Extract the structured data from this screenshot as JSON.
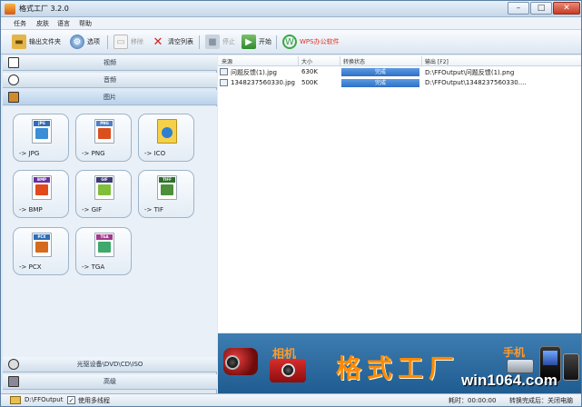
{
  "window": {
    "title": "格式工厂 3.2.0",
    "controls": {
      "minimize": "–",
      "maximize": "□",
      "close": "✕"
    }
  },
  "menu": [
    "任务",
    "皮肤",
    "语言",
    "帮助"
  ],
  "toolbar": {
    "output_folder": "输出文件夹",
    "options": "选项",
    "remove": "移除",
    "clear_list": "清空列表",
    "stop": "停止",
    "start": "开始",
    "wps": "WPS办公软件"
  },
  "categories": {
    "video": "视频",
    "audio": "音频",
    "image": "图片",
    "rom": "光驱设备\\DVD\\CD\\ISO",
    "advanced": "高级"
  },
  "formats": [
    {
      "label": "-> JPG",
      "tag": "JPG",
      "tag_color": "#2f6db5",
      "pic_color": "#3a8fd6"
    },
    {
      "label": "-> PNG",
      "tag": "PNG",
      "tag_color": "#4d7fc4",
      "pic_color": "#d9501e"
    },
    {
      "label": "-> ICO",
      "tag": "",
      "tag_color": "#e8b30d",
      "pic_color": "#2f7fd1"
    },
    {
      "label": "-> BMP",
      "tag": "BMP",
      "tag_color": "#6b2fa0",
      "pic_color": "#e04a1c"
    },
    {
      "label": "-> GIF",
      "tag": "GIF",
      "tag_color": "#3c3c7a",
      "pic_color": "#7fbf3a"
    },
    {
      "label": "-> TIF",
      "tag": "TIFF",
      "tag_color": "#2d6e2d",
      "pic_color": "#4d8f3a"
    },
    {
      "label": "-> PCX",
      "tag": "PCX",
      "tag_color": "#2f6db5",
      "pic_color": "#d66a1e"
    },
    {
      "label": "-> TGA",
      "tag": "TGA",
      "tag_color": "#a03a8a",
      "pic_color": "#3fa86b"
    }
  ],
  "table": {
    "headers": {
      "source": "来源",
      "size": "大小",
      "status": "转换状态",
      "output": "输出 [F2]"
    },
    "rows": [
      {
        "source": "问题反馈(1).jpg",
        "size": "630K",
        "status": "完成",
        "output": "D:\\FFOutput\\问题反馈(1).png"
      },
      {
        "source": "1348237560330.jpg",
        "size": "500K",
        "status": "完成",
        "output": "D:\\FFOutput\\1348237560330...."
      }
    ]
  },
  "banner": {
    "camera_word": "相机",
    "brand": "格式工厂",
    "phone_word": "手机",
    "watermark": "win1064.com"
  },
  "statusbar": {
    "output_path": "D:\\FFOutput",
    "multithread_checked": "✓",
    "multithread_label": "使用多线程",
    "time_label": "耗时：00:00:00",
    "after_label": "转换完成后：关闭电脑"
  }
}
